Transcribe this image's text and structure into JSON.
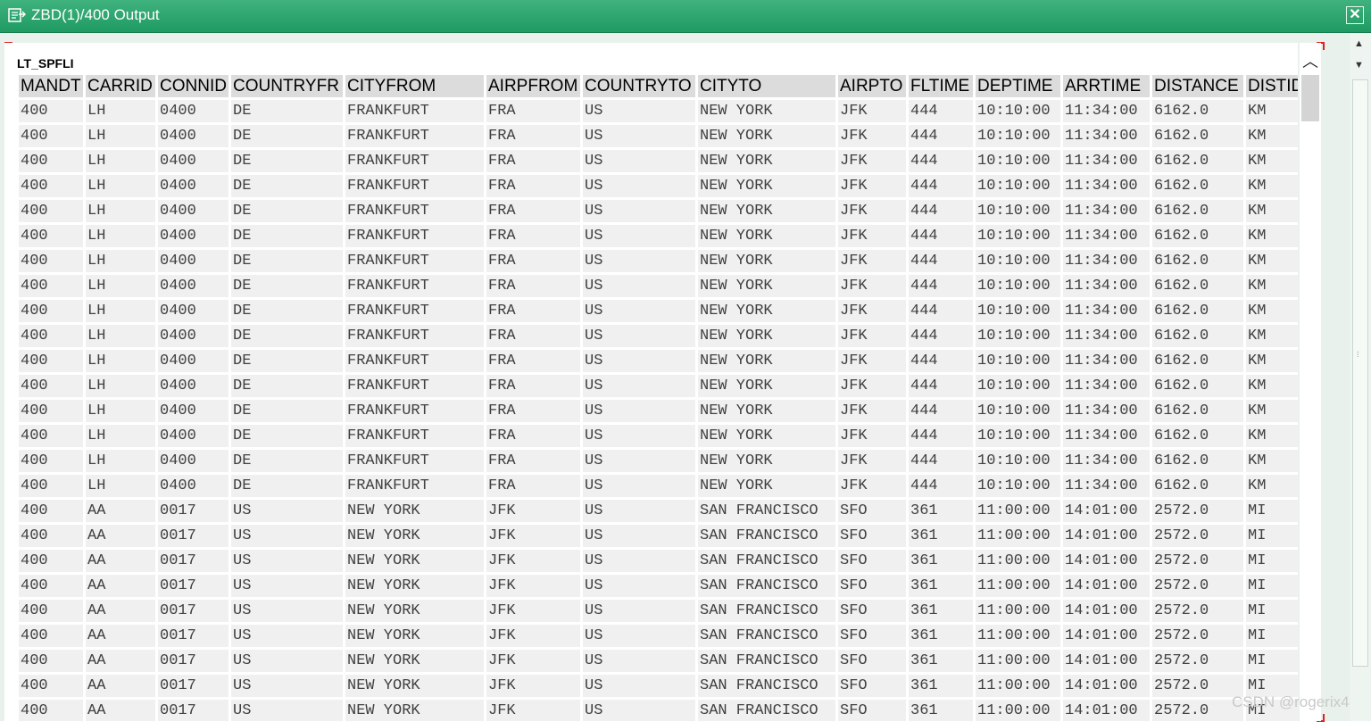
{
  "window": {
    "title": "ZBD(1)/400 Output",
    "close_glyph": "✕",
    "icon": "list-output-icon"
  },
  "list": {
    "title": "LT_SPFLI",
    "columns": [
      {
        "key": "mandt",
        "label": "MANDT"
      },
      {
        "key": "carrid",
        "label": "CARRID"
      },
      {
        "key": "connid",
        "label": "CONNID"
      },
      {
        "key": "countryfr",
        "label": "COUNTRYFR"
      },
      {
        "key": "cityfrom",
        "label": "CITYFROM"
      },
      {
        "key": "airpfrom",
        "label": "AIRPFROM"
      },
      {
        "key": "countryto",
        "label": "COUNTRYTO"
      },
      {
        "key": "cityto",
        "label": "CITYTO"
      },
      {
        "key": "airpto",
        "label": "AIRPTO"
      },
      {
        "key": "fltime",
        "label": "FLTIME"
      },
      {
        "key": "deptime",
        "label": "DEPTIME"
      },
      {
        "key": "arrtime",
        "label": "ARRTIME"
      },
      {
        "key": "distance",
        "label": "DISTANCE"
      },
      {
        "key": "distid",
        "label": "DISTID"
      }
    ],
    "rows": [
      [
        "400",
        "LH",
        "0400",
        "DE",
        "FRANKFURT",
        "FRA",
        "US",
        "NEW YORK",
        "JFK",
        "444",
        "10:10:00",
        "11:34:00",
        "6162.0",
        "KM"
      ],
      [
        "400",
        "LH",
        "0400",
        "DE",
        "FRANKFURT",
        "FRA",
        "US",
        "NEW YORK",
        "JFK",
        "444",
        "10:10:00",
        "11:34:00",
        "6162.0",
        "KM"
      ],
      [
        "400",
        "LH",
        "0400",
        "DE",
        "FRANKFURT",
        "FRA",
        "US",
        "NEW YORK",
        "JFK",
        "444",
        "10:10:00",
        "11:34:00",
        "6162.0",
        "KM"
      ],
      [
        "400",
        "LH",
        "0400",
        "DE",
        "FRANKFURT",
        "FRA",
        "US",
        "NEW YORK",
        "JFK",
        "444",
        "10:10:00",
        "11:34:00",
        "6162.0",
        "KM"
      ],
      [
        "400",
        "LH",
        "0400",
        "DE",
        "FRANKFURT",
        "FRA",
        "US",
        "NEW YORK",
        "JFK",
        "444",
        "10:10:00",
        "11:34:00",
        "6162.0",
        "KM"
      ],
      [
        "400",
        "LH",
        "0400",
        "DE",
        "FRANKFURT",
        "FRA",
        "US",
        "NEW YORK",
        "JFK",
        "444",
        "10:10:00",
        "11:34:00",
        "6162.0",
        "KM"
      ],
      [
        "400",
        "LH",
        "0400",
        "DE",
        "FRANKFURT",
        "FRA",
        "US",
        "NEW YORK",
        "JFK",
        "444",
        "10:10:00",
        "11:34:00",
        "6162.0",
        "KM"
      ],
      [
        "400",
        "LH",
        "0400",
        "DE",
        "FRANKFURT",
        "FRA",
        "US",
        "NEW YORK",
        "JFK",
        "444",
        "10:10:00",
        "11:34:00",
        "6162.0",
        "KM"
      ],
      [
        "400",
        "LH",
        "0400",
        "DE",
        "FRANKFURT",
        "FRA",
        "US",
        "NEW YORK",
        "JFK",
        "444",
        "10:10:00",
        "11:34:00",
        "6162.0",
        "KM"
      ],
      [
        "400",
        "LH",
        "0400",
        "DE",
        "FRANKFURT",
        "FRA",
        "US",
        "NEW YORK",
        "JFK",
        "444",
        "10:10:00",
        "11:34:00",
        "6162.0",
        "KM"
      ],
      [
        "400",
        "LH",
        "0400",
        "DE",
        "FRANKFURT",
        "FRA",
        "US",
        "NEW YORK",
        "JFK",
        "444",
        "10:10:00",
        "11:34:00",
        "6162.0",
        "KM"
      ],
      [
        "400",
        "LH",
        "0400",
        "DE",
        "FRANKFURT",
        "FRA",
        "US",
        "NEW YORK",
        "JFK",
        "444",
        "10:10:00",
        "11:34:00",
        "6162.0",
        "KM"
      ],
      [
        "400",
        "LH",
        "0400",
        "DE",
        "FRANKFURT",
        "FRA",
        "US",
        "NEW YORK",
        "JFK",
        "444",
        "10:10:00",
        "11:34:00",
        "6162.0",
        "KM"
      ],
      [
        "400",
        "LH",
        "0400",
        "DE",
        "FRANKFURT",
        "FRA",
        "US",
        "NEW YORK",
        "JFK",
        "444",
        "10:10:00",
        "11:34:00",
        "6162.0",
        "KM"
      ],
      [
        "400",
        "LH",
        "0400",
        "DE",
        "FRANKFURT",
        "FRA",
        "US",
        "NEW YORK",
        "JFK",
        "444",
        "10:10:00",
        "11:34:00",
        "6162.0",
        "KM"
      ],
      [
        "400",
        "LH",
        "0400",
        "DE",
        "FRANKFURT",
        "FRA",
        "US",
        "NEW YORK",
        "JFK",
        "444",
        "10:10:00",
        "11:34:00",
        "6162.0",
        "KM"
      ],
      [
        "400",
        "AA",
        "0017",
        "US",
        "NEW YORK",
        "JFK",
        "US",
        "SAN FRANCISCO",
        "SFO",
        "361",
        "11:00:00",
        "14:01:00",
        "2572.0",
        "MI"
      ],
      [
        "400",
        "AA",
        "0017",
        "US",
        "NEW YORK",
        "JFK",
        "US",
        "SAN FRANCISCO",
        "SFO",
        "361",
        "11:00:00",
        "14:01:00",
        "2572.0",
        "MI"
      ],
      [
        "400",
        "AA",
        "0017",
        "US",
        "NEW YORK",
        "JFK",
        "US",
        "SAN FRANCISCO",
        "SFO",
        "361",
        "11:00:00",
        "14:01:00",
        "2572.0",
        "MI"
      ],
      [
        "400",
        "AA",
        "0017",
        "US",
        "NEW YORK",
        "JFK",
        "US",
        "SAN FRANCISCO",
        "SFO",
        "361",
        "11:00:00",
        "14:01:00",
        "2572.0",
        "MI"
      ],
      [
        "400",
        "AA",
        "0017",
        "US",
        "NEW YORK",
        "JFK",
        "US",
        "SAN FRANCISCO",
        "SFO",
        "361",
        "11:00:00",
        "14:01:00",
        "2572.0",
        "MI"
      ],
      [
        "400",
        "AA",
        "0017",
        "US",
        "NEW YORK",
        "JFK",
        "US",
        "SAN FRANCISCO",
        "SFO",
        "361",
        "11:00:00",
        "14:01:00",
        "2572.0",
        "MI"
      ],
      [
        "400",
        "AA",
        "0017",
        "US",
        "NEW YORK",
        "JFK",
        "US",
        "SAN FRANCISCO",
        "SFO",
        "361",
        "11:00:00",
        "14:01:00",
        "2572.0",
        "MI"
      ],
      [
        "400",
        "AA",
        "0017",
        "US",
        "NEW YORK",
        "JFK",
        "US",
        "SAN FRANCISCO",
        "SFO",
        "361",
        "11:00:00",
        "14:01:00",
        "2572.0",
        "MI"
      ],
      [
        "400",
        "AA",
        "0017",
        "US",
        "NEW YORK",
        "JFK",
        "US",
        "SAN FRANCISCO",
        "SFO",
        "361",
        "11:00:00",
        "14:01:00",
        "2572.0",
        "MI"
      ]
    ]
  },
  "scroll": {
    "up_glyph": "▲",
    "down_glyph": "▼",
    "inner_up_glyph": "︿",
    "grip_glyph": "⁞"
  },
  "watermark": "CSDN @rogerix4"
}
